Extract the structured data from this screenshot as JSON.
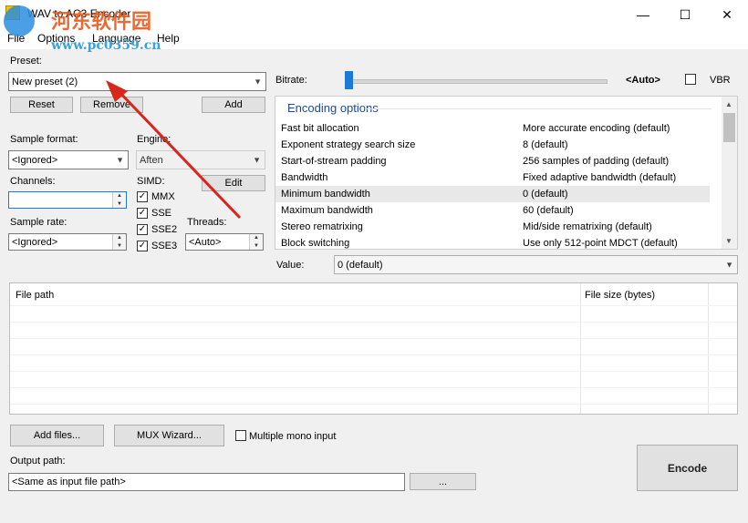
{
  "window": {
    "title": "WAV to AC3 Encoder",
    "minimize": "—",
    "maximize": "☐",
    "close": "✕"
  },
  "watermark": {
    "title": "河东软件园",
    "url": "www.pc0359.cn"
  },
  "menu": [
    {
      "label": "File"
    },
    {
      "label": "Options"
    },
    {
      "label": "Language"
    },
    {
      "label": "Help"
    }
  ],
  "preset": {
    "label": "Preset:",
    "value": "New preset (2)",
    "reset": "Reset",
    "remove": "Remove",
    "add": "Add"
  },
  "sample_format": {
    "label": "Sample format:",
    "value": "<Ignored>"
  },
  "engine": {
    "label": "Engine:",
    "value": "Aften",
    "edit": "Edit"
  },
  "channels": {
    "label": "Channels:",
    "value": ""
  },
  "simd": {
    "label": "SIMD:",
    "options": [
      {
        "label": "MMX",
        "checked": true
      },
      {
        "label": "SSE",
        "checked": true
      },
      {
        "label": "SSE2",
        "checked": true
      },
      {
        "label": "SSE3",
        "checked": true
      }
    ]
  },
  "sample_rate": {
    "label": "Sample rate:",
    "value": "<Ignored>"
  },
  "threads": {
    "label": "Threads:",
    "value": "<Auto>"
  },
  "bitrate": {
    "label": "Bitrate:",
    "value": "<Auto>",
    "vbr_label": "VBR",
    "vbr_checked": false,
    "slider_position": 0
  },
  "encoding": {
    "header": "Encoding options",
    "rows": [
      {
        "key": "Fast bit allocation",
        "value": "More accurate encoding (default)"
      },
      {
        "key": "Exponent strategy search size",
        "value": "8 (default)"
      },
      {
        "key": "Start-of-stream padding",
        "value": "256 samples of padding (default)"
      },
      {
        "key": "Bandwidth",
        "value": "Fixed adaptive bandwidth (default)"
      },
      {
        "key": "Minimum bandwidth",
        "value": "0 (default)",
        "selected": true
      },
      {
        "key": "Maximum bandwidth",
        "value": "60 (default)"
      },
      {
        "key": "Stereo rematrixing",
        "value": "Mid/side rematrixing (default)"
      },
      {
        "key": "Block switching",
        "value": "Use only 512-point MDCT (default)"
      }
    ]
  },
  "value": {
    "label": "Value:",
    "current": "0 (default)"
  },
  "filelist": {
    "col_path": "File path",
    "col_size": "File size (bytes)"
  },
  "bottom": {
    "add_files": "Add files...",
    "mux_wizard": "MUX Wizard...",
    "multiple_mono": "Multiple mono input",
    "output_label": "Output path:",
    "output_value": "<Same as input file path>",
    "browse": "...",
    "encode": "Encode"
  },
  "colors": {
    "arrow": "#d9261c",
    "selection": "#e8e8e8",
    "slider_thumb": "#1e78d6"
  }
}
